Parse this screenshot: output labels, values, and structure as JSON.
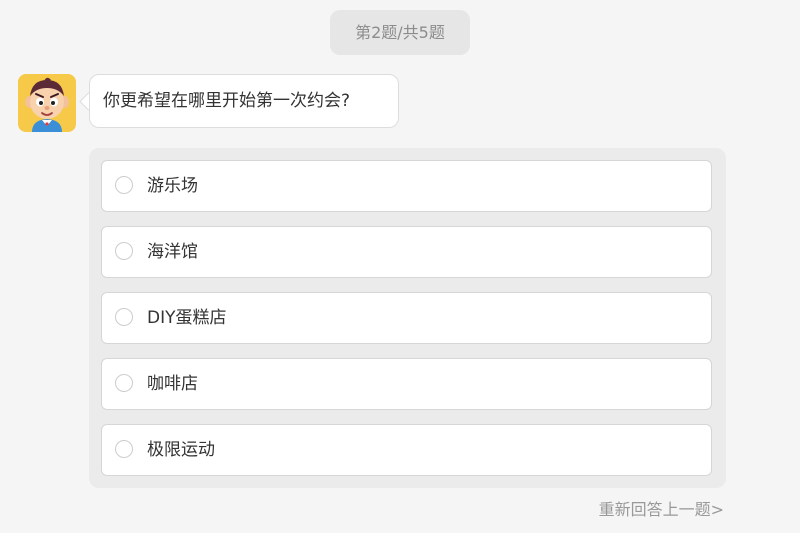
{
  "progress": {
    "text": "第2题/共5题"
  },
  "question": {
    "avatar_icon": "cartoon-boy-avatar",
    "text": "你更希望在哪里开始第一次约会?"
  },
  "options": [
    {
      "label": "游乐场",
      "selected": false
    },
    {
      "label": "海洋馆",
      "selected": false
    },
    {
      "label": "DIY蛋糕店",
      "selected": false
    },
    {
      "label": "咖啡店",
      "selected": false
    },
    {
      "label": "极限运动",
      "selected": false
    }
  ],
  "footer": {
    "redo_link": "重新回答上一题>"
  },
  "colors": {
    "page_background": "#f5f5f5",
    "options_panel": "#ebebeb",
    "avatar_background": "#f7c948",
    "muted_text": "#999999"
  }
}
